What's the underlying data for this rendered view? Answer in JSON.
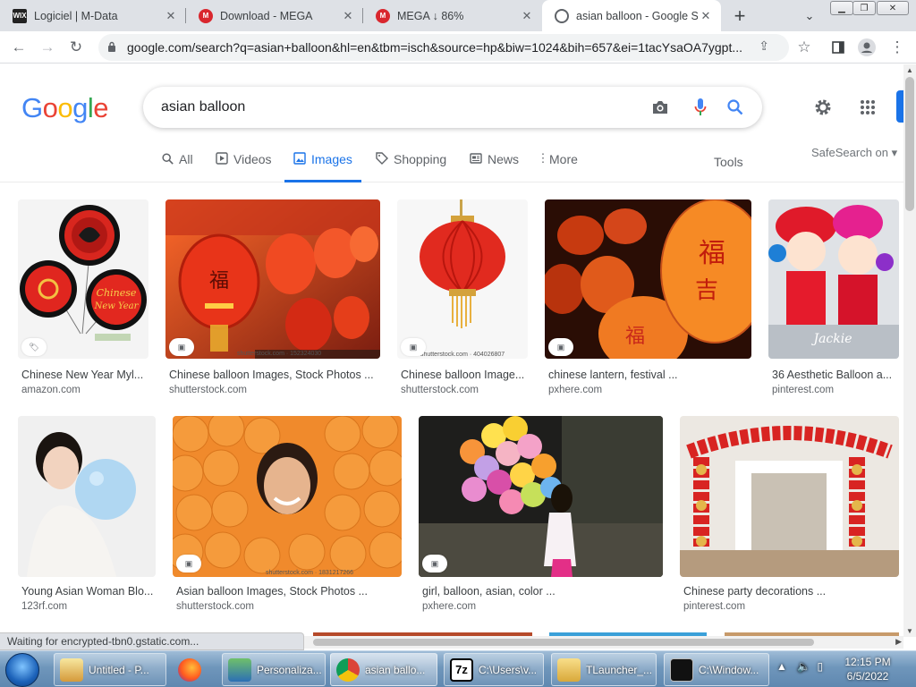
{
  "browser": {
    "tabs": [
      {
        "title": "Logiciel | M-Data",
        "fav": "WIX"
      },
      {
        "title": "Download - MEGA",
        "fav": "M"
      },
      {
        "title": "MEGA ↓ 86%",
        "fav": "M"
      },
      {
        "title": "asian balloon - Google Se",
        "fav": ""
      }
    ],
    "url": "google.com/search?q=asian+balloon&hl=en&tbm=isch&source=hp&biw=1024&bih=657&ei=1tacYsaOA7ygpt..."
  },
  "google": {
    "query": "asian balloon",
    "nav": [
      "All",
      "Videos",
      "Images",
      "Shopping",
      "News",
      "More"
    ],
    "tools": "Tools",
    "safesearch": "SafeSearch on"
  },
  "results": [
    {
      "caption": "Chinese New Year Myl...",
      "source": "amazon.com",
      "watermark": ""
    },
    {
      "caption": "Chinese balloon Images, Stock Photos ...",
      "source": "shutterstock.com",
      "watermark": "shutterstock.com · 152324030"
    },
    {
      "caption": "Chinese balloon Image...",
      "source": "shutterstock.com",
      "watermark": "shutterstock.com · 404026807"
    },
    {
      "caption": "chinese lantern, festival ...",
      "source": "pxhere.com",
      "watermark": ""
    },
    {
      "caption": "36 Aesthetic Balloon a...",
      "source": "pinterest.com",
      "watermark": ""
    },
    {
      "caption": "Young Asian Woman Blo...",
      "source": "123rf.com",
      "watermark": ""
    },
    {
      "caption": "Asian balloon Images, Stock Photos ...",
      "source": "shutterstock.com",
      "watermark": "shutterstock.com · 1831217266"
    },
    {
      "caption": "girl, balloon, asian, color ...",
      "source": "pxhere.com",
      "watermark": ""
    },
    {
      "caption": "Chinese party decorations ...",
      "source": "pinterest.com",
      "watermark": ""
    }
  ],
  "status": "Waiting for encrypted-tbn0.gstatic.com...",
  "taskbar": {
    "items": [
      "Untitled - P...",
      "Personaliza...",
      "asian ballo...",
      "C:\\Users\\v...",
      "TLauncher_...",
      "C:\\Window..."
    ],
    "time": "12:15 PM",
    "date": "6/5/2022"
  },
  "colors": {
    "accent": "#1a73e8",
    "tabstrip": "#dee1e6"
  }
}
